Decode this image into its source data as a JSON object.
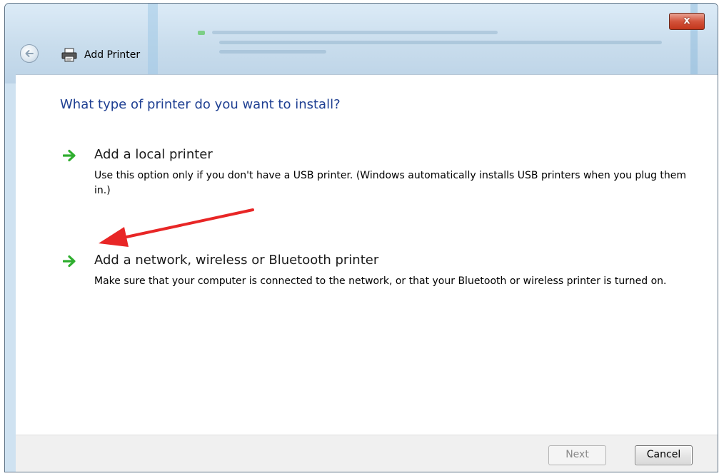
{
  "window": {
    "title": "Add Printer",
    "close_glyph": "x"
  },
  "content": {
    "heading": "What type of printer do you want to install?",
    "options": [
      {
        "title": "Add a local printer",
        "description": "Use this option only if you don't have a USB printer. (Windows automatically installs USB printers when you plug them in.)",
        "icon": "green-arrow-icon"
      },
      {
        "title": "Add a network, wireless or Bluetooth printer",
        "description": "Make sure that your computer is connected to the network, or that your Bluetooth or wireless printer is turned on.",
        "icon": "green-arrow-icon"
      }
    ]
  },
  "footer": {
    "next_label": "Next",
    "cancel_label": "Cancel"
  },
  "colors": {
    "heading": "#1e3f92",
    "option_arrow": "#2fae2f",
    "annotation_arrow": "#e82626",
    "close_button": "#c9442b"
  }
}
